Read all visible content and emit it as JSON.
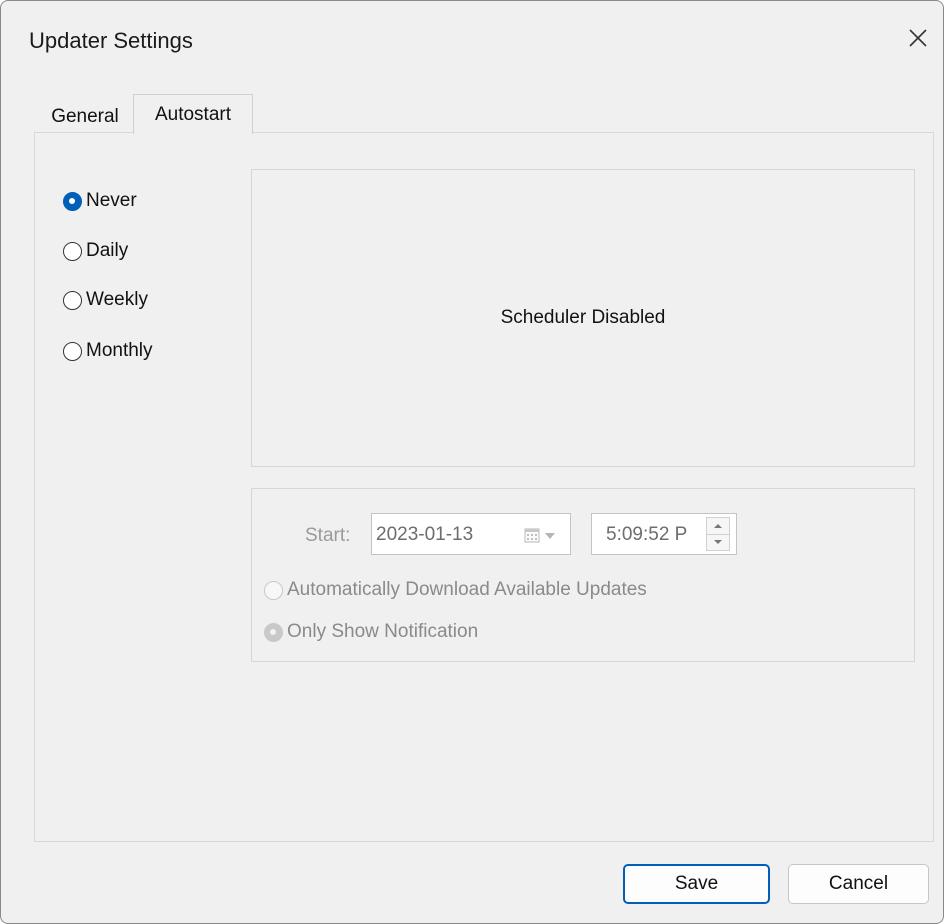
{
  "window": {
    "title": "Updater Settings"
  },
  "tabs": {
    "general": "General",
    "autostart": "Autostart",
    "active": "Autostart"
  },
  "schedule": {
    "options": [
      "Never",
      "Daily",
      "Weekly",
      "Monthly"
    ],
    "selected": "Never"
  },
  "scheduler_status": "Scheduler Disabled",
  "start": {
    "label": "Start:",
    "date": "2023-01-13",
    "time": "5:09:52 P"
  },
  "update_action": {
    "options": [
      "Automatically Download Available Updates",
      "Only Show Notification"
    ],
    "selected": "Only Show Notification",
    "enabled": false
  },
  "buttons": {
    "save": "Save",
    "cancel": "Cancel"
  },
  "icons": {
    "close": "close-icon",
    "calendar": "calendar-icon",
    "dropdown": "chevron-down-icon",
    "spin_up": "spin-up-icon",
    "spin_down": "spin-down-icon"
  },
  "colors": {
    "accent": "#005fb8",
    "background": "#f0f0f0",
    "disabled_text": "#8a8a8a"
  }
}
